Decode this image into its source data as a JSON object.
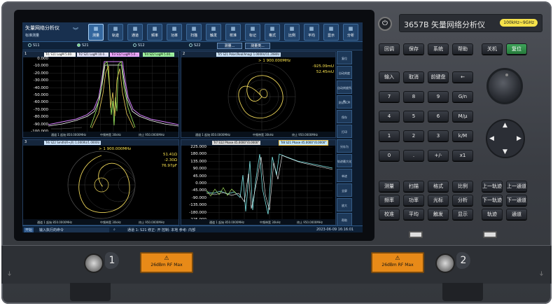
{
  "topbar": {
    "title": "矢量网络分析仪",
    "subtitle": "标准测量",
    "buttons": [
      {
        "label": "测量",
        "icon": "measure-icon",
        "active": true
      },
      {
        "label": "轨迹",
        "icon": "trace-icon"
      },
      {
        "label": "通道",
        "icon": "channel-icon"
      },
      {
        "label": "频率",
        "icon": "frequency-icon"
      },
      {
        "label": "功率",
        "icon": "power-icon"
      },
      {
        "label": "扫描",
        "icon": "sweep-icon"
      },
      {
        "label": "触发",
        "icon": "trigger-icon"
      },
      {
        "label": "校准",
        "icon": "calibration-icon"
      },
      {
        "label": "标记",
        "icon": "marker-icon"
      },
      {
        "label": "格式",
        "icon": "format-icon"
      },
      {
        "label": "比例",
        "icon": "scale-icon"
      },
      {
        "label": "平均",
        "icon": "average-icon"
      },
      {
        "label": "显示",
        "icon": "display-icon"
      },
      {
        "label": "分析",
        "icon": "analysis-icon"
      }
    ]
  },
  "params": {
    "items": [
      "S11",
      "S21",
      "S12",
      "S22"
    ],
    "selected": "S21",
    "btn1": "测量...",
    "btn2": "测量类..."
  },
  "windows": {
    "w1": {
      "num": "1",
      "tags": [
        "Tr1 S11 LogM 5.00...",
        "Tr2 S21 LogM 10.0...",
        "Tr3 S12 LogM 5.0...",
        "Tr4 S22 LogM 5.00..."
      ],
      "yticks": [
        "0.000",
        "-10.000",
        "-20.000",
        "-30.000",
        "-40.000",
        "-50.000",
        "-60.000",
        "-70.000",
        "-80.000",
        "-90.000",
        "-100.000"
      ],
      "footer": {
        "start": "通道 1 起始 850.0000MHz",
        "ifbw": "中频带宽 30kHz",
        "stop": "终止 950.0000MHz"
      }
    },
    "w2": {
      "num": "2",
      "tag": "Tr5 S21 Polar(Real/Imag) 1.0000U/11.2080U",
      "marker": "> 1   900.000MHz",
      "r1": "-925.09mU",
      "r2": "52.45mU",
      "footer": {
        "start": "通道 1 起始 850.0000MHz",
        "ifbw": "中频带宽 30kHz",
        "stop": "终止 950.0000MHz"
      }
    },
    "w3": {
      "num": "3",
      "tag": "Tr6 S22 Smith(R+jX) 1.0000U/1.0000U",
      "marker": "> 1   900.000MHz",
      "r1": "51.41Ω",
      "r2": "-2.30Ω",
      "r3": "76.97pF",
      "footer": {
        "start": "通道 1 起始 850.0000MHz",
        "ifbw": "中频带宽 30kHz",
        "stop": "终止 950.0000MHz"
      }
    },
    "w4": {
      "num": "4",
      "tags": [
        "Tr7 S12 Phase 45.0000°/0.0000°",
        "Tr8 S21 Phase 45.0000°/0.0000°"
      ],
      "yticks": [
        "225.000",
        "180.000",
        "135.000",
        "90.000",
        "45.000",
        "0.000",
        "-45.000",
        "-90.000",
        "-135.000",
        "-180.000",
        "-225.000"
      ],
      "footer": {
        "start": "通道 1 起始 850.0000MHz",
        "ifbw": "中频带宽 30kHz",
        "stop": "终止 950.0000MHz"
      }
    }
  },
  "sidebar": [
    "复位",
    "自动刻度",
    "自动刻度所有",
    "测试SCPI",
    "保存",
    "打印",
    "另存为",
    "轨迹最大化",
    "单迹",
    "全屏",
    "放大",
    "帮助"
  ],
  "status": {
    "start_label": "开始",
    "input_placeholder": "输入执行的命令",
    "message": "通道 1: S21 修正: 开  控制: 本地  参考: 内部",
    "datetime": "2023-06-09 16:16:01"
  },
  "panel": {
    "model": "3657B 矢量网络分析仪",
    "freq_range": "100kHz~9GHz",
    "row1": [
      "回调",
      "保存",
      "系统",
      "帮助"
    ],
    "row1b": [
      "关机",
      "复位"
    ],
    "row2": [
      "输入",
      "取消",
      "前键盘",
      "←"
    ],
    "keypad": [
      [
        "7",
        "8",
        "9",
        "G/n"
      ],
      [
        "4",
        "5",
        "6",
        "M/μ"
      ],
      [
        "1",
        "2",
        "3",
        "k/M"
      ],
      [
        "0",
        ".",
        "+/-",
        "x1"
      ]
    ],
    "func": [
      [
        "测量",
        "扫描",
        "格式",
        "比例"
      ],
      [
        "频率",
        "功率",
        "光标",
        "分析"
      ],
      [
        "校准",
        "平均",
        "触发",
        "显示"
      ]
    ],
    "nav": [
      [
        "上一轨迹",
        "上一通道"
      ],
      [
        "下一轨迹",
        "下一通道"
      ],
      [
        "轨迹",
        "通道"
      ]
    ]
  },
  "ports": {
    "p1": "1",
    "p2": "2",
    "warning": "26dBm RF Max"
  }
}
